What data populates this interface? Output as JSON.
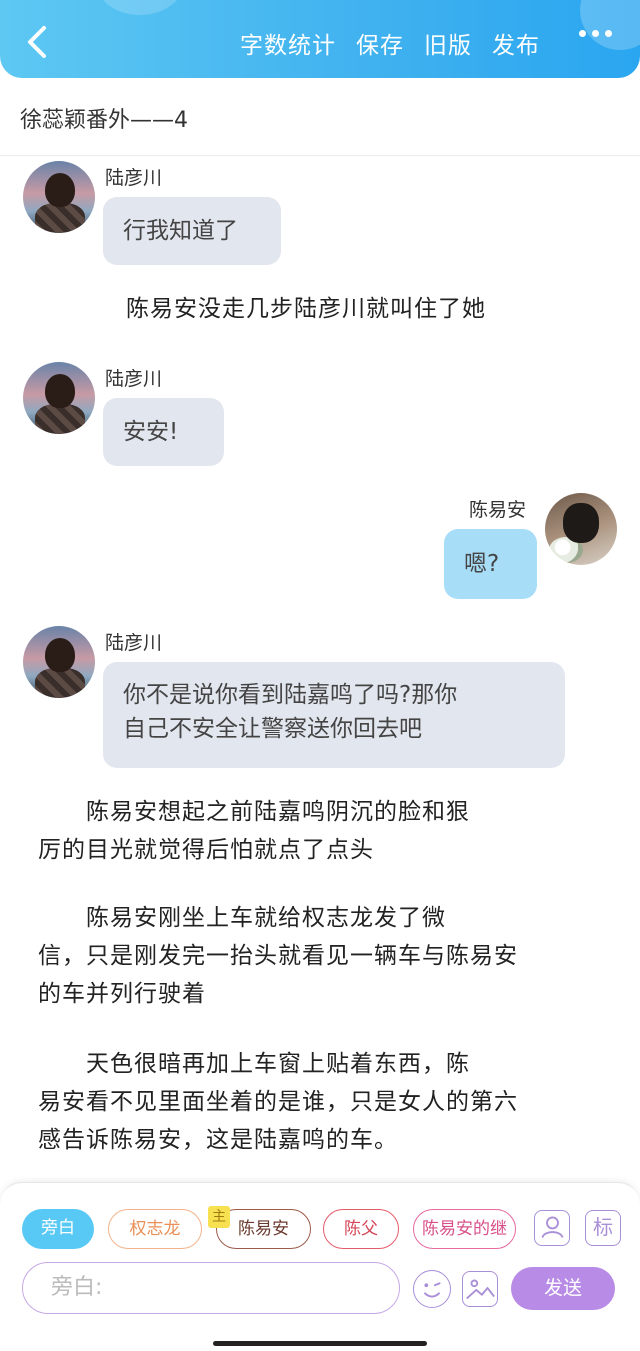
{
  "topbar": {
    "actions": [
      "字数统计",
      "保存",
      "旧版",
      "发布"
    ]
  },
  "title": "徐蕊颖番外——4",
  "messages": [
    {
      "speaker": "陆彦川",
      "text": "行我知道了"
    },
    {
      "narration": "陈易安没走几步陆彦川就叫住了她"
    },
    {
      "speaker": "陆彦川",
      "text": "安安!"
    },
    {
      "speaker": "陈易安",
      "text": "嗯?"
    },
    {
      "speaker": "陆彦川",
      "text_line1": "你不是说你看到陆嘉鸣了吗?那你",
      "text_line2": "自己不安全让警察送你回去吧"
    }
  ],
  "narrations": [
    {
      "line1": "　　陈易安想起之前陆嘉鸣阴沉的脸和狠",
      "line2": "厉的目光就觉得后怕就点了点头"
    },
    {
      "line1": "　　陈易安刚坐上车就给权志龙发了微",
      "line2": "信，只是刚发完一抬头就看见一辆车与陈易安",
      "line3": "的车并列行驶着"
    },
    {
      "line1": "　　天色很暗再加上车窗上贴着东西，陈",
      "line2": "易安看不见里面坐着的是谁，只是女人的第六",
      "line3": "感告诉陈易安，这是陆嘉鸣的车。"
    }
  ],
  "bottom": {
    "chips": [
      "旁白",
      "权志龙",
      "陈易安",
      "陈父",
      "陈易安的继"
    ],
    "main_tag": "主",
    "tag_icon": "标",
    "input_placeholder": "旁白:",
    "send_label": "发送"
  },
  "colors": {
    "topbar_start": "#5ec8f3",
    "topbar_end": "#2aa6f0",
    "bubble_left": "#e2e6ee",
    "bubble_right": "#a8ddf8",
    "send_button": "#b88be6",
    "accent_purple": "#a98fd8"
  },
  "icons": [
    "back-icon",
    "more-icon",
    "avatar-icon",
    "emoji-icon",
    "image-icon"
  ]
}
